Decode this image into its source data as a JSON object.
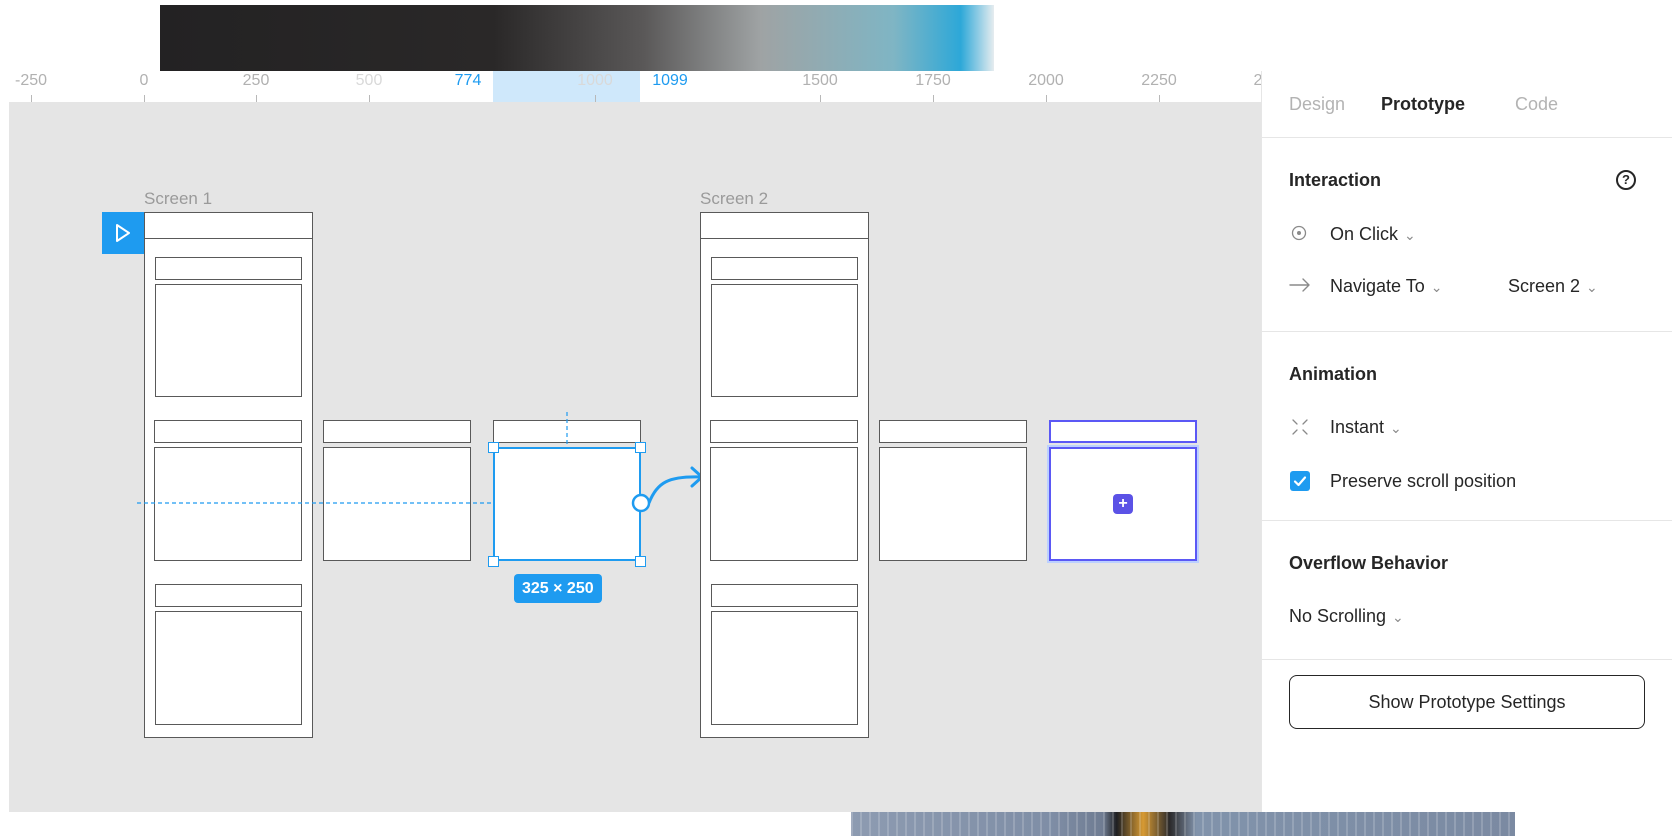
{
  "ruler": {
    "ticks": [
      "-250",
      "0",
      "250",
      "500",
      "774",
      "1000",
      "1099",
      "1500",
      "1750",
      "2000",
      "2250",
      "2"
    ]
  },
  "canvas": {
    "frames": [
      {
        "label": "Screen 1"
      },
      {
        "label": "Screen 2"
      }
    ],
    "selection_size": "325 × 250",
    "add_glyph": "+"
  },
  "panel": {
    "tabs": [
      {
        "label": "Design",
        "active": false
      },
      {
        "label": "Prototype",
        "active": true
      },
      {
        "label": "Code",
        "active": false
      }
    ],
    "interaction": {
      "title": "Interaction",
      "help_glyph": "?",
      "trigger": "On Click",
      "action": "Navigate To",
      "destination": "Screen 2"
    },
    "animation": {
      "title": "Animation",
      "type": "Instant",
      "preserve_scroll_label": "Preserve scroll position",
      "preserve_scroll_checked": true
    },
    "overflow": {
      "title": "Overflow Behavior",
      "value": "No Scrolling"
    },
    "settings_button": "Show Prototype Settings"
  },
  "colors": {
    "accent": "#1e9bf0",
    "hover": "#5b58f5",
    "canvas_bg": "#e5e5e5"
  }
}
